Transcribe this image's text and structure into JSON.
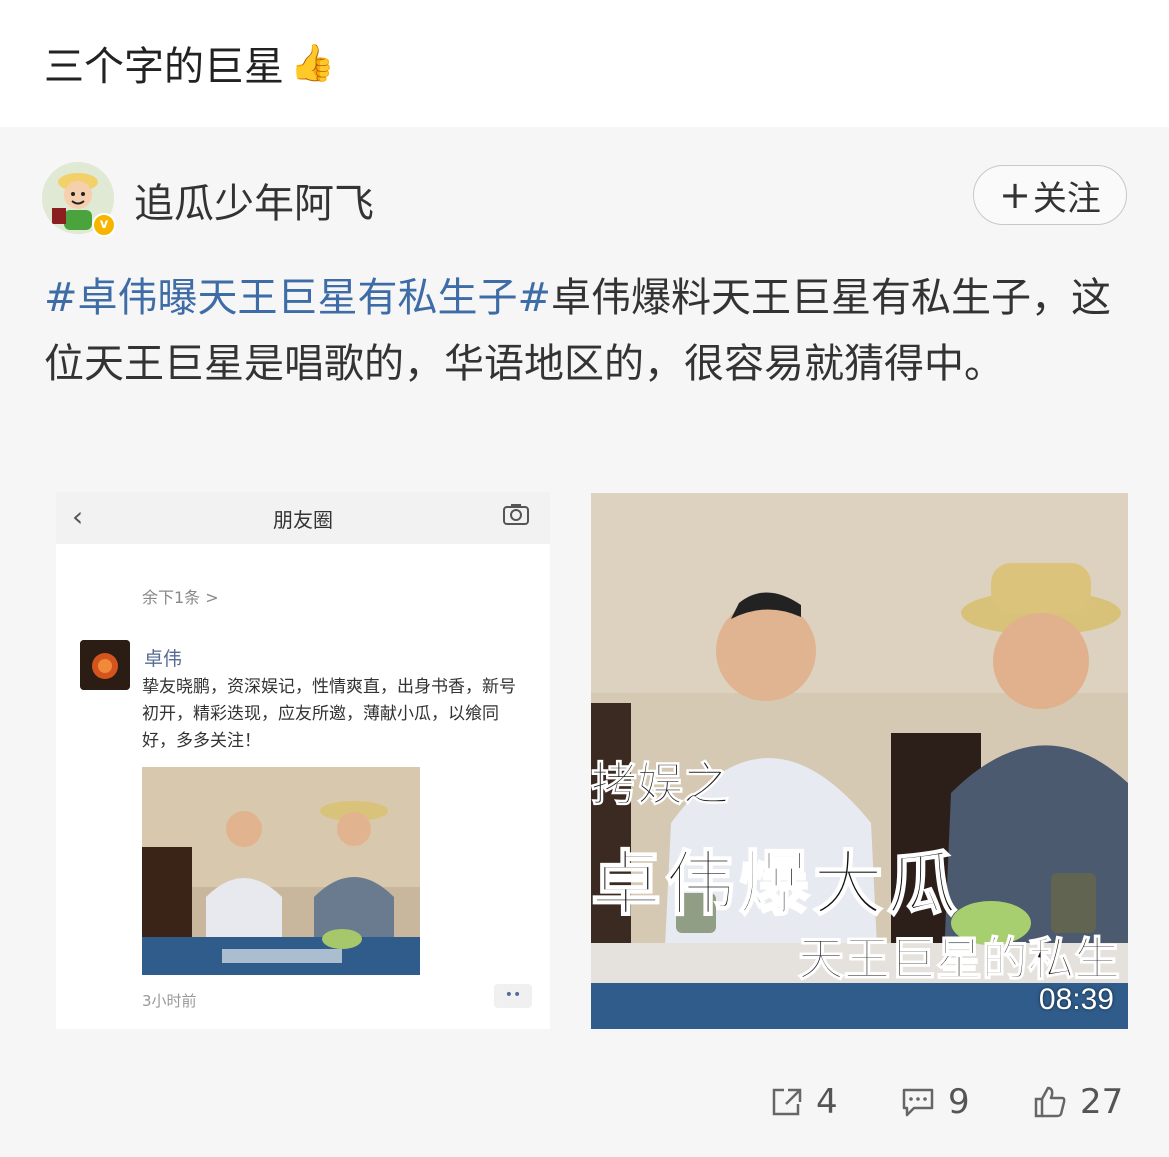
{
  "comment": {
    "text": "三个字的巨星",
    "emoji": "👍"
  },
  "post": {
    "author": "追瓜少年阿飞",
    "follow_label": "关注",
    "hashtag": "#卓伟曝天王巨星有私生子#",
    "body": "卓伟爆料天王巨星有私生子，这位天王巨星是唱歌的，华语地区的，很容易就猜得中。"
  },
  "left_image": {
    "header_title": "朋友圈",
    "more_link": "余下1条 >",
    "poster_name": "卓伟",
    "moment_text": "挚友晓鹏，资深娱记，性情爽直，出身书香，新号初开，精彩迭现，应友所邀，薄献小瓜，以飨同好，多多关注！",
    "time": "3小时前",
    "dots": "••"
  },
  "right_image": {
    "caption_small": "拷娱之",
    "caption_big": "卓伟爆大瓜",
    "caption_sub": "天王巨星的私生",
    "duration": "08:39"
  },
  "actions": {
    "share_count": "4",
    "comment_count": "9",
    "like_count": "27"
  },
  "colors": {
    "hashtag": "#3e6ca6",
    "card_bg": "#f6f6f6",
    "verify": "#f7b500"
  }
}
